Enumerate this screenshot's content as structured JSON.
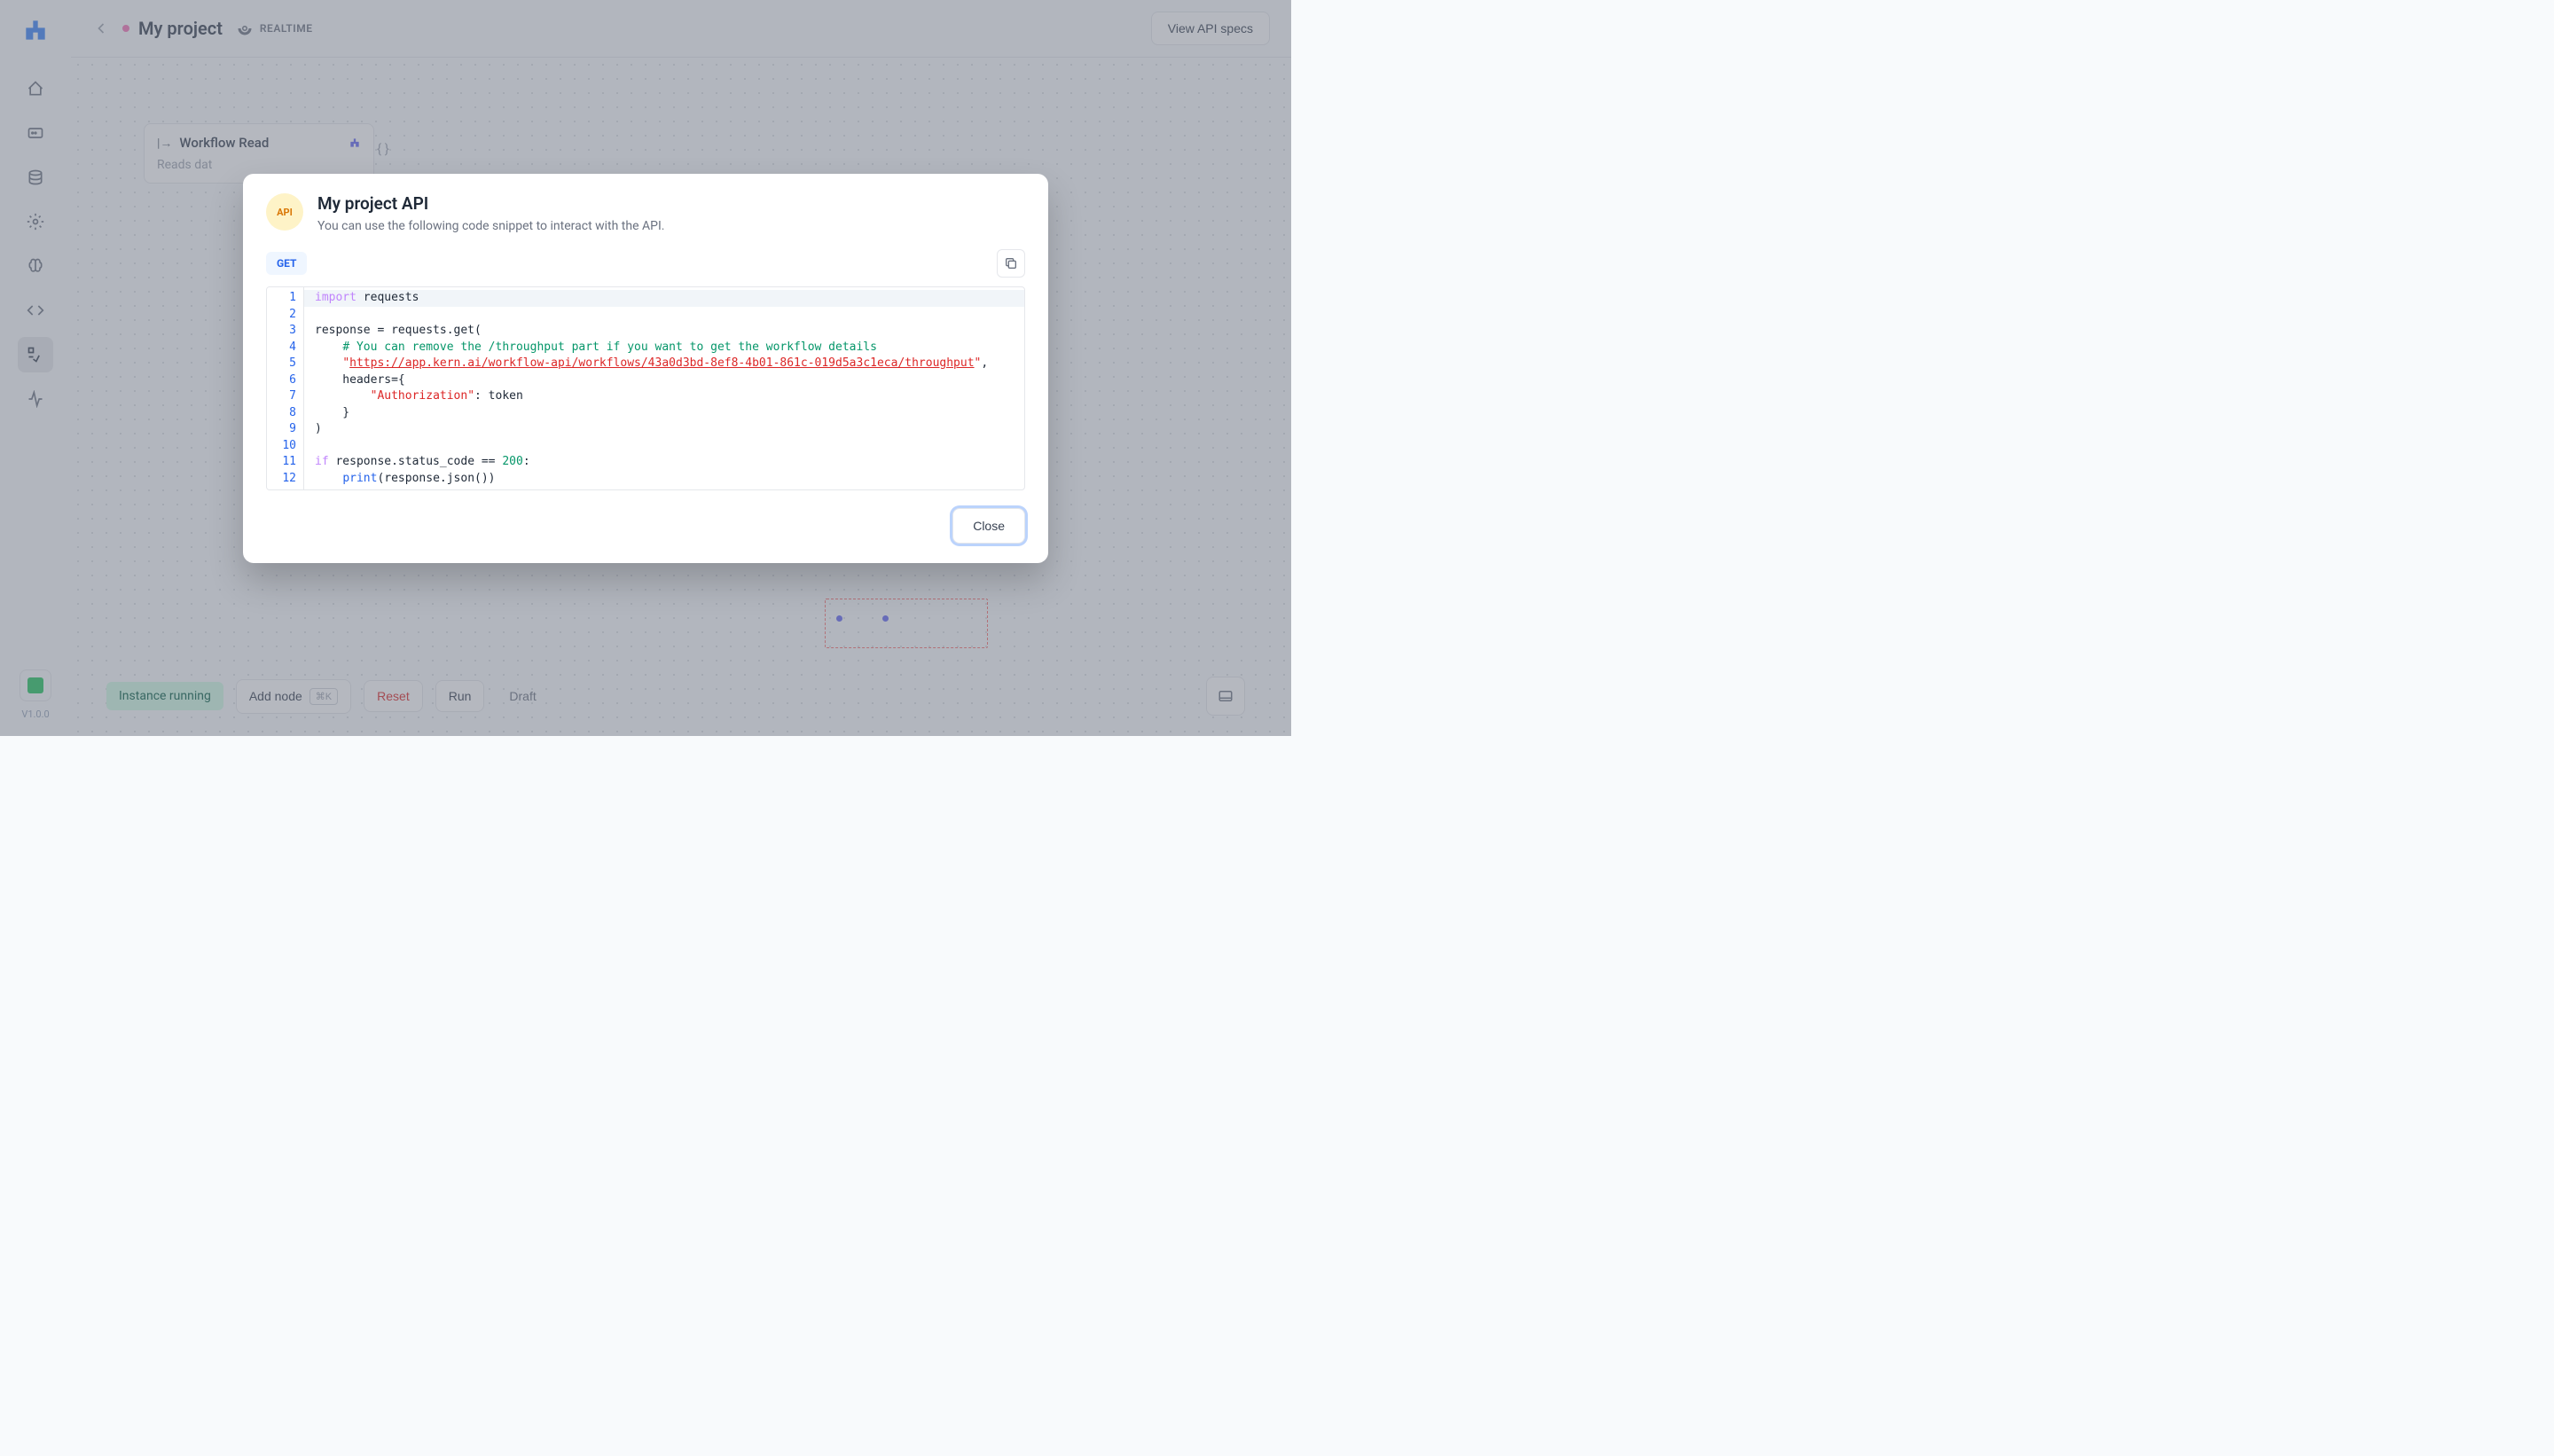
{
  "header": {
    "project_title": "My project",
    "realtime_label": "REALTIME",
    "view_api_btn": "View API specs"
  },
  "sidebar": {
    "version": "V1.0.0"
  },
  "canvas": {
    "node": {
      "title": "Workflow Read",
      "description": "Reads dat"
    }
  },
  "bottombar": {
    "instance_status": "Instance running",
    "add_node": "Add node",
    "add_node_kbd": "⌘K",
    "reset": "Reset",
    "run": "Run",
    "draft": "Draft"
  },
  "modal": {
    "api_badge": "API",
    "title": "My project API",
    "subtitle": "You can use the following code snippet to interact with the API.",
    "method": "GET",
    "close": "Close",
    "code": {
      "url": "https://app.kern.ai/workflow-api/workflows/43a0d3bd-8ef8-4b01-861c-019d5a3c1eca/throughput",
      "comment": "# You can remove the /throughput part if you want to get the workflow details",
      "auth_key": "\"Authorization\"",
      "status_ok": "200",
      "line_count": 12
    }
  }
}
